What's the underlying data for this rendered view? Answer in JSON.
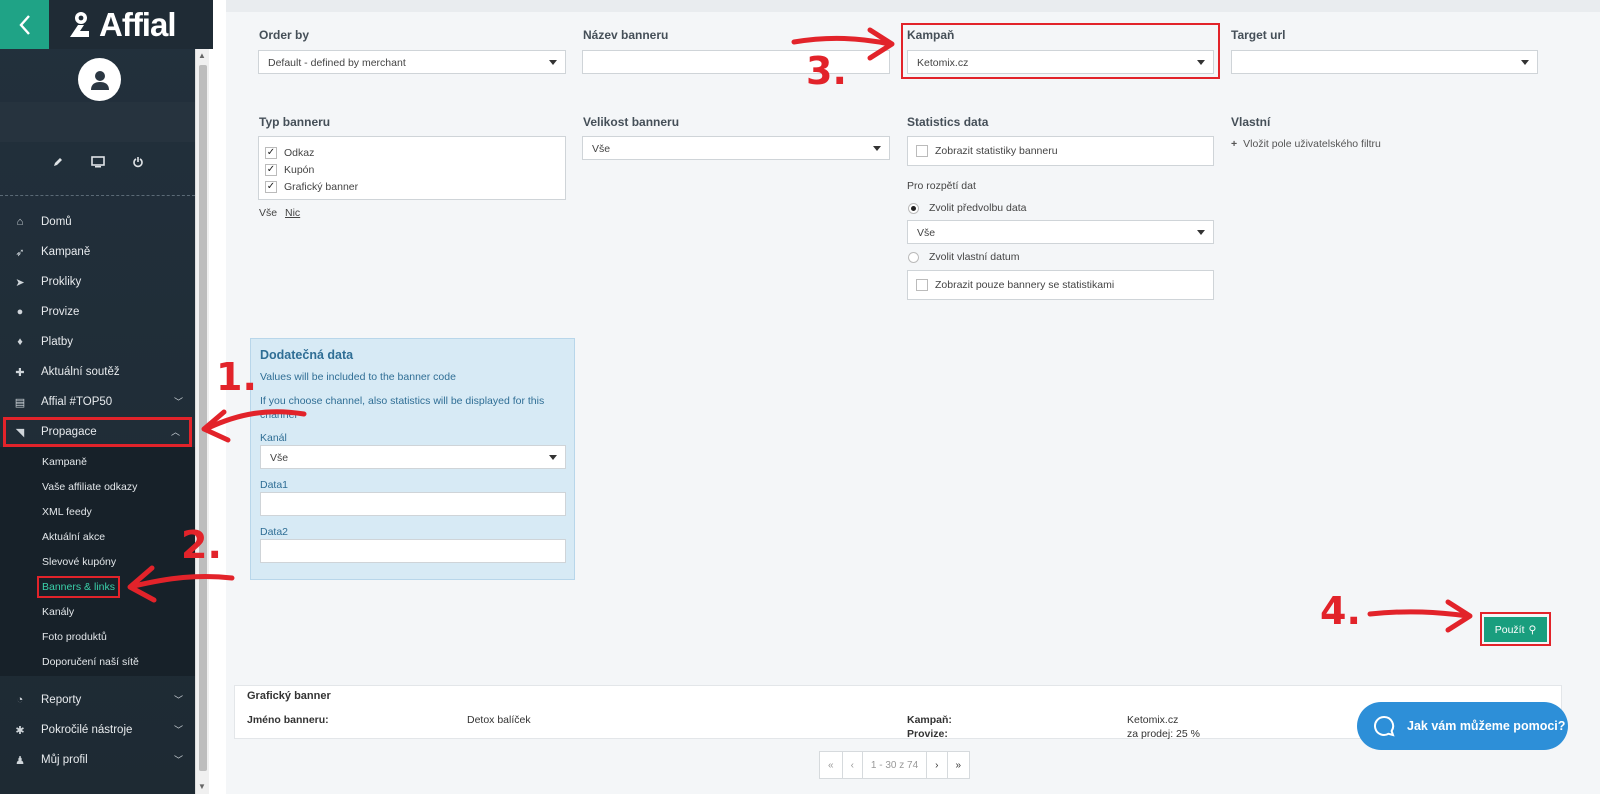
{
  "brand": {
    "name": "Affial",
    "accent": "#1fa386",
    "alert": "#e2232a"
  },
  "sidebar": {
    "tools": [
      "pencil-icon",
      "monitor-icon",
      "power-icon"
    ],
    "items": [
      {
        "label": "Domů",
        "icon": "home-icon"
      },
      {
        "label": "Kampaně",
        "icon": "rocket-icon"
      },
      {
        "label": "Prokliky",
        "icon": "pointer-icon"
      },
      {
        "label": "Provize",
        "icon": "coins-icon"
      },
      {
        "label": "Platby",
        "icon": "moneybag-icon"
      },
      {
        "label": "Aktuální soutěž",
        "icon": "puzzle-icon"
      },
      {
        "label": "Affial #TOP50",
        "icon": "book-icon"
      },
      {
        "label": "Propagace",
        "icon": "megaphone-icon"
      }
    ],
    "submenu": [
      "Kampaně",
      "Vaše affiliate odkazy",
      "XML feedy",
      "Aktuální akce",
      "Slevové kupóny",
      "Banners & links",
      "Kanály",
      "Foto produktů",
      "Doporučení naší sítě"
    ],
    "bottom_items": [
      {
        "label": "Reporty",
        "icon": "chart-icon"
      },
      {
        "label": "Pokročilé nástroje",
        "icon": "cogs-icon"
      },
      {
        "label": "Můj profil",
        "icon": "user-icon"
      }
    ]
  },
  "filters": {
    "order_by": {
      "label": "Order by",
      "value": "Default - defined by merchant"
    },
    "banner_name": {
      "label": "Název banneru",
      "value": ""
    },
    "campaign": {
      "label": "Kampaň",
      "value": "Ketomix.cz"
    },
    "target_url": {
      "label": "Target url",
      "value": ""
    },
    "banner_type": {
      "label": "Typ banneru",
      "options": [
        "Odkaz",
        "Kupón",
        "Grafický banner"
      ],
      "all": "Vše",
      "none": "Nic"
    },
    "banner_size": {
      "label": "Velikost banneru",
      "value": "Vše"
    },
    "statistics": {
      "label": "Statistics data",
      "show_stats": "Zobrazit statistiky banneru",
      "range_label": "Pro rozpětí dat",
      "preset_label": "Zvolit předvolbu data",
      "preset_value": "Vše",
      "custom_label": "Zvolit vlastní datum",
      "only_with_stats": "Zobrazit pouze bannery se statistikami"
    },
    "custom": {
      "label": "Vlastní",
      "add_link": "Vložit pole uživatelského filtru"
    }
  },
  "extra_data": {
    "title": "Dodatečná data",
    "text1": "Values will be included to the banner code",
    "text2": "If you choose channel, also statistics will be displayed for this channel",
    "channel_label": "Kanál",
    "channel_value": "Vše",
    "data1_label": "Data1",
    "data2_label": "Data2"
  },
  "apply_button": "Použít",
  "result": {
    "title": "Grafický banner",
    "name_label": "Jméno banneru:",
    "name_value": "Detox balíček",
    "campaign_label": "Kampaň:",
    "campaign_value": "Ketomix.cz",
    "commission_label": "Provize:",
    "commission_value": "za prodej: 25 %"
  },
  "pager": {
    "first": "«",
    "prev": "‹",
    "range": "1 - 30 z 74",
    "next": "›",
    "last": "»"
  },
  "help_button": "Jak vám můžeme pomoci?",
  "annotations": {
    "a1": "1.",
    "a2": "2.",
    "a3": "3.",
    "a4": "4."
  }
}
